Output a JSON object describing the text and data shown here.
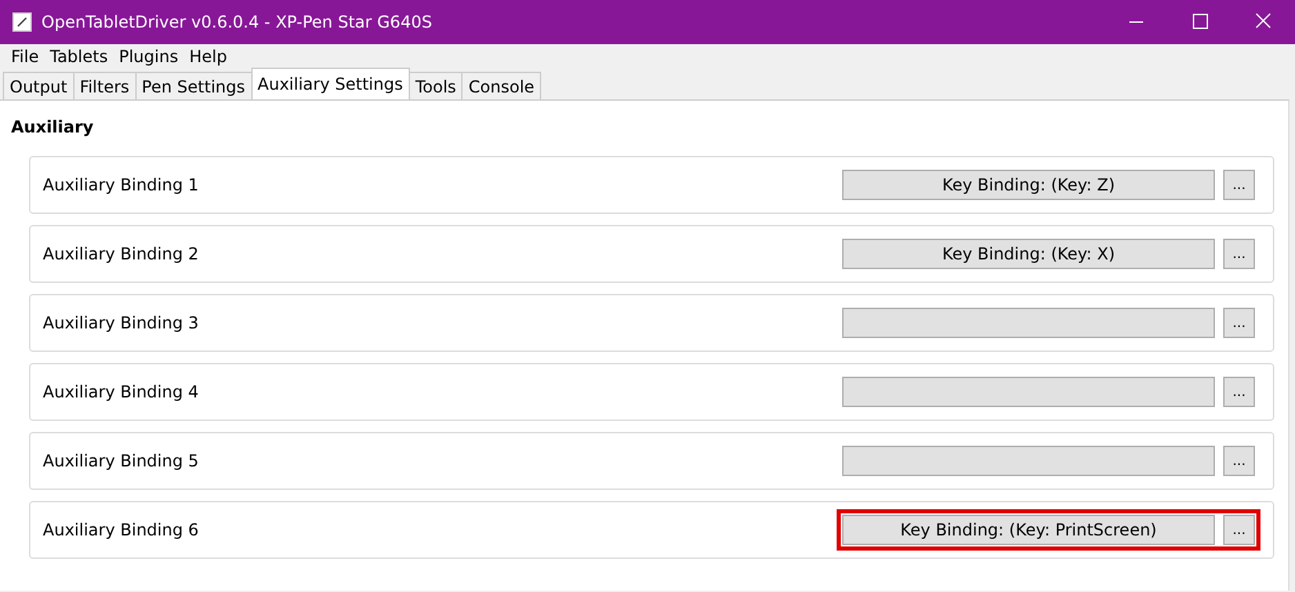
{
  "window": {
    "title": "OpenTabletDriver v0.6.0.4 - XP-Pen Star G640S"
  },
  "menu": [
    "File",
    "Tablets",
    "Plugins",
    "Help"
  ],
  "tabs": [
    {
      "label": "Output",
      "selected": false
    },
    {
      "label": "Filters",
      "selected": false
    },
    {
      "label": "Pen Settings",
      "selected": false
    },
    {
      "label": "Auxiliary Settings",
      "selected": true
    },
    {
      "label": "Tools",
      "selected": false
    },
    {
      "label": "Console",
      "selected": false
    }
  ],
  "section": {
    "title": "Auxiliary"
  },
  "bindings": [
    {
      "label": "Auxiliary Binding 1",
      "binding": "Key Binding: (Key: Z)",
      "more": "...",
      "highlighted": false
    },
    {
      "label": "Auxiliary Binding 2",
      "binding": "Key Binding: (Key: X)",
      "more": "...",
      "highlighted": false
    },
    {
      "label": "Auxiliary Binding 3",
      "more": "...",
      "highlighted": false
    },
    {
      "label": "Auxiliary Binding 4",
      "more": "...",
      "highlighted": false
    },
    {
      "label": "Auxiliary Binding 5",
      "more": "...",
      "highlighted": false
    },
    {
      "label": "Auxiliary Binding 6",
      "binding": "Key Binding: (Key: PrintScreen)",
      "more": "...",
      "highlighted": true
    }
  ]
}
